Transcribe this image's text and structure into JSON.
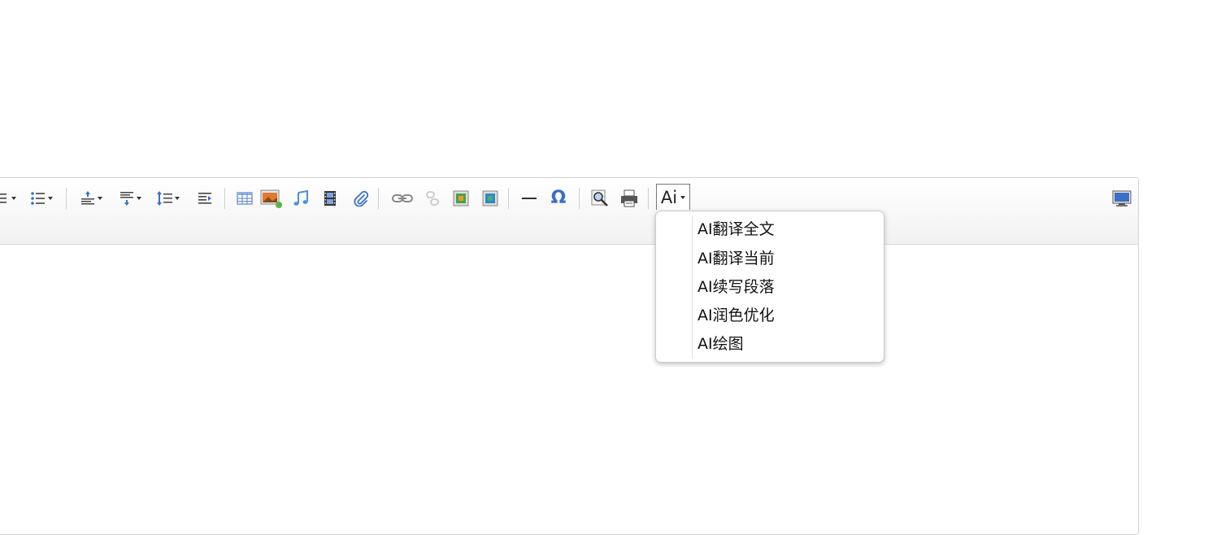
{
  "toolbar": {
    "ai_button_label": "Ai",
    "icons": [
      "ordered-list-icon",
      "unordered-list-icon",
      "paragraph-spacing-top-icon",
      "paragraph-spacing-bottom-icon",
      "line-height-icon",
      "indent-icon",
      "table-icon",
      "image-icon",
      "music-icon",
      "video-icon",
      "attachment-icon",
      "link-icon",
      "unlink-icon",
      "image-left-icon",
      "image-right-icon",
      "horizontal-rule-icon",
      "special-char-icon",
      "preview-icon",
      "print-icon",
      "fullscreen-icon"
    ]
  },
  "ai_menu": {
    "items": [
      {
        "label": "AI翻译全文"
      },
      {
        "label": "AI翻译当前"
      },
      {
        "label": "AI续写段落"
      },
      {
        "label": "AI润色优化"
      },
      {
        "label": "AI绘图"
      }
    ]
  },
  "glyphs": {
    "omega": "Ω"
  },
  "colors": {
    "toolbar_bg": "#f5f5f5",
    "icon_blue": "#3a6fc4",
    "border": "#d4d4d4"
  }
}
